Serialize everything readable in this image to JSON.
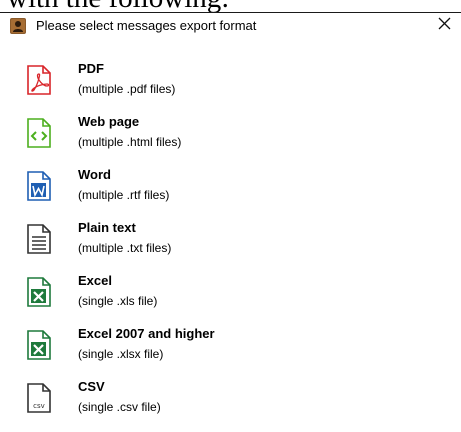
{
  "page_fragment": "with the following:",
  "dialog": {
    "title": "Please select messages export format",
    "close_glyph": "✕"
  },
  "options": [
    {
      "name": "PDF",
      "description": "(multiple .pdf files)",
      "icon": "pdf-icon"
    },
    {
      "name": "Web page",
      "description": "(multiple .html files)",
      "icon": "html-icon"
    },
    {
      "name": "Word",
      "description": "(multiple .rtf files)",
      "icon": "word-icon"
    },
    {
      "name": "Plain text",
      "description": "(multiple .txt files)",
      "icon": "text-file-icon"
    },
    {
      "name": "Excel",
      "description": "(single .xls file)",
      "icon": "excel-icon"
    },
    {
      "name": "Excel 2007 and higher",
      "description": "(single .xlsx file)",
      "icon": "excel-icon"
    },
    {
      "name": "CSV",
      "description": "(single .csv file)",
      "icon": "csv-icon",
      "icon_text": "csv"
    }
  ],
  "colors": {
    "pdf": "#d9252a",
    "html": "#4caf1e",
    "word": "#1f5fb3",
    "excel": "#1e7a3c",
    "neutral": "#333333"
  }
}
